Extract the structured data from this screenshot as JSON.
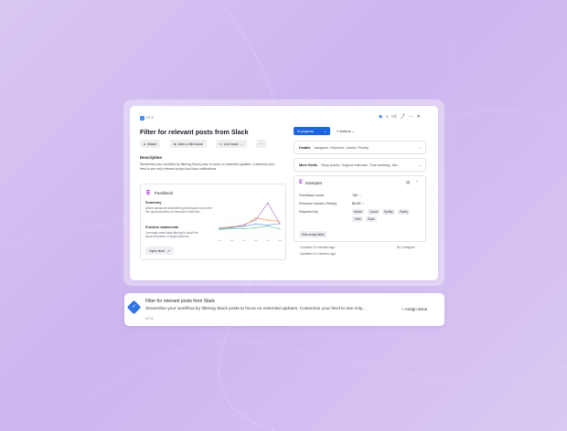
{
  "issue": {
    "key": "LP-5",
    "title": "Filter for relevant posts from Slack",
    "header_icons": {
      "watch_count": "5"
    },
    "buttons": {
      "attach": "Attach",
      "add_child": "Add a child issue",
      "link": "Link issue",
      "more": "···"
    },
    "description_heading": "Description",
    "description": "Streamline your workflow by filtering Slack posts to focus on essential updates. Customize your feed to see only relevant project and task notifications.",
    "status": "In progress",
    "actions": "Actions"
  },
  "feedback_panel": {
    "title": "Feedback",
    "summary_heading": "Summary",
    "summary_text": "Utilize advanced data filtering techniques to prevent the synchronization of extensive historical...",
    "problem_heading": "Problem statements",
    "problem_text": "Leverage smart data filtering to avoid the synchronization of large historical...",
    "open_feed": "Open feed"
  },
  "details": {
    "label": "Details",
    "value": "Assignee, Reporter, Labels, Priority"
  },
  "more_fields": {
    "label": "More fields",
    "value": "Story points, Original estimate, Time tracking, Sta..."
  },
  "enterpret": {
    "title": "Enterpret",
    "fields": [
      {
        "label": "Feedback count",
        "value": "782"
      },
      {
        "label": "Revenue impact (Yearly)",
        "value": "$4.5K"
      },
      {
        "label": "Reported by",
        "value": ""
      }
    ],
    "reporters": [
      "Notion",
      "Canva",
      "Spotify",
      "Pipefy",
      "Trello",
      "Slack"
    ],
    "hide_empty": "Hide empty fields"
  },
  "meta": {
    "created": "Created 15 minutes ago",
    "updated": "Updated 13 minutes ago",
    "configure": "Configure"
  },
  "bottom_bar": {
    "title": "Filter for relevant posts from Slack",
    "description": "Streamline your workflow by filtering Slack posts to focus on essential updates. Customize your feed to see only...",
    "key": "LP-5",
    "assign": "+ Assign issue"
  },
  "colors": {
    "accent": "#1d64e0",
    "enterpret": "#a43bd6",
    "background": "#d8c6f2"
  },
  "chart_data": {
    "type": "line",
    "title": "",
    "x": [
      1,
      2,
      3,
      4,
      5,
      6
    ],
    "ylim": [
      0,
      10
    ],
    "series": [
      {
        "color": "#b07fcf",
        "values": [
          2.6,
          2.7,
          3.4,
          4.6,
          9.2,
          3.6
        ]
      },
      {
        "color": "#f0a15c",
        "values": [
          2.4,
          2.9,
          3.0,
          5.2,
          4.6,
          4.3
        ]
      },
      {
        "color": "#6fa3e8",
        "values": [
          2.3,
          2.6,
          2.9,
          3.6,
          3.3,
          3.7
        ]
      },
      {
        "color": "#72c59a",
        "values": [
          2.1,
          2.4,
          2.3,
          2.6,
          3.0,
          2.3
        ]
      }
    ]
  }
}
